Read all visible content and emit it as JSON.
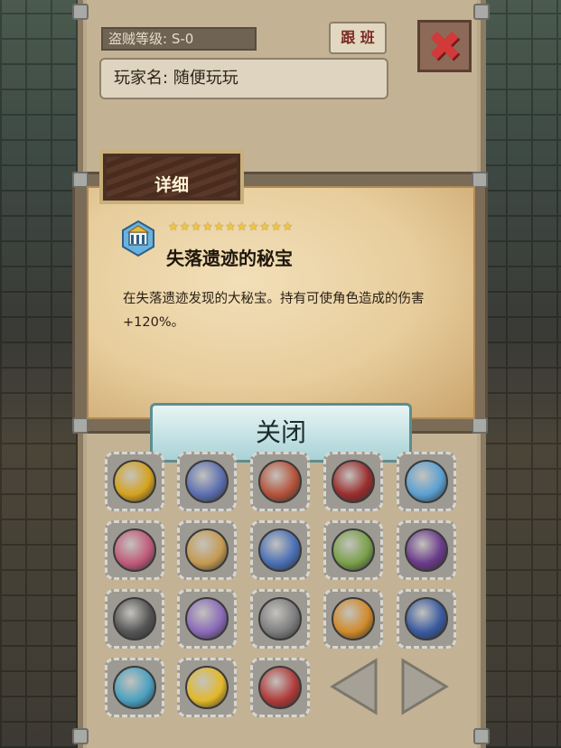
{
  "header": {
    "thief_level": "盗贼等级: S-0",
    "follow_label": "跟 班",
    "player_name": "玩家名: 随便玩玩"
  },
  "dialog": {
    "tab_title": "详细",
    "stars": "★★★★★★★★★★★",
    "item_name": "失落遗迹的秘宝",
    "item_desc": "在失落遗迹发现的大秘宝。持有可使角色造成的伤害+120%。",
    "close_label": "关闭"
  },
  "colors": {
    "close_x": "#d23a3a",
    "star": "#f1c63e",
    "close_button": "#c8e4e6"
  },
  "items": [
    {
      "icon": "gold-star-medal-icon",
      "color": "#d4a21e"
    },
    {
      "icon": "blue-swirl-orb-icon",
      "color": "#5b6fb0"
    },
    {
      "icon": "crossed-swords-shield-icon",
      "color": "#b5523a"
    },
    {
      "icon": "red-gem-crown-icon",
      "color": "#9a2d2d"
    },
    {
      "icon": "blue-temple-relic-icon",
      "color": "#5aa0d2"
    },
    {
      "icon": "pink-spellbook-icon",
      "color": "#c05a7a"
    },
    {
      "icon": "lion-head-icon",
      "color": "#c49a52"
    },
    {
      "icon": "blue-book-scroll-icon",
      "color": "#4a6fb5"
    },
    {
      "icon": "green-feather-bow-icon",
      "color": "#7aa04a"
    },
    {
      "icon": "purple-potion-icon",
      "color": "#6a3a8a"
    },
    {
      "icon": "wolf-head-icon",
      "color": "#555555"
    },
    {
      "icon": "purple-wing-shield-icon",
      "color": "#8a6ab8"
    },
    {
      "icon": "silver-hexagon-gem-icon",
      "color": "#7d7d7d"
    },
    {
      "icon": "orange-honey-hexagon-icon",
      "color": "#d08a2a"
    },
    {
      "icon": "blue-crystal-octagon-icon",
      "color": "#3a5aa0"
    },
    {
      "icon": "crossed-blue-swords-icon",
      "color": "#4aa0c0"
    },
    {
      "icon": "golden-mask-icon",
      "color": "#e2b82a"
    },
    {
      "icon": "red-demon-face-icon",
      "color": "#b03a3a"
    }
  ]
}
